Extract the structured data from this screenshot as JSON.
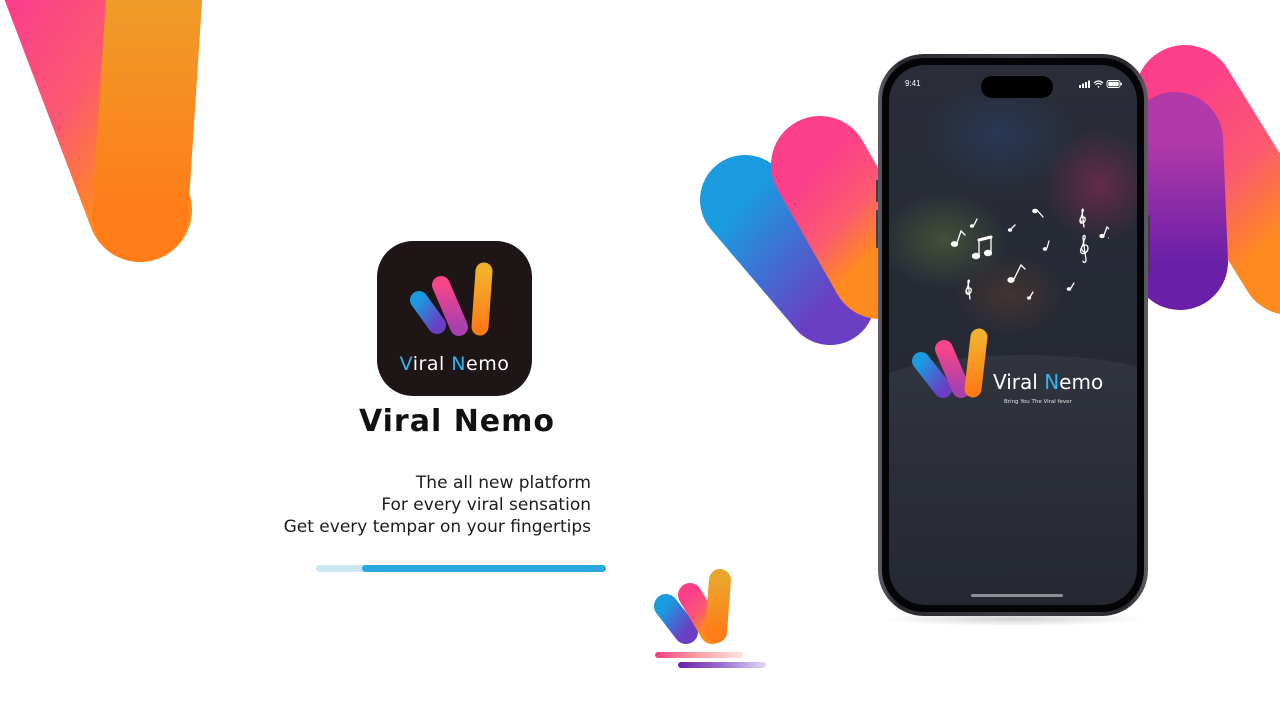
{
  "brand": {
    "name_part1": "V",
    "name_part2": "iral ",
    "name_part3": "N",
    "name_part4": "emo",
    "title": "Viral Nemo",
    "slogan": "Bring You The Viral fever"
  },
  "tagline": {
    "line1": "The all new platform",
    "line2": "For every viral sensation",
    "line3": "Get every tempar on your fingertips"
  },
  "progress": {
    "value": 0.84
  },
  "phone": {
    "status_time": "9:41"
  },
  "icons": {
    "app_icon": "viral-nemo-logo-icon",
    "status": [
      "signal-icon",
      "wifi-icon",
      "battery-icon"
    ],
    "music": "music-notes-icon"
  },
  "colors": {
    "blue": "#2496e0",
    "purple": "#7e24b4",
    "pink": "#f4458a",
    "orange": "#ff8a17",
    "yellow": "#f2b12c",
    "accent_text": "#2fb6ef"
  }
}
